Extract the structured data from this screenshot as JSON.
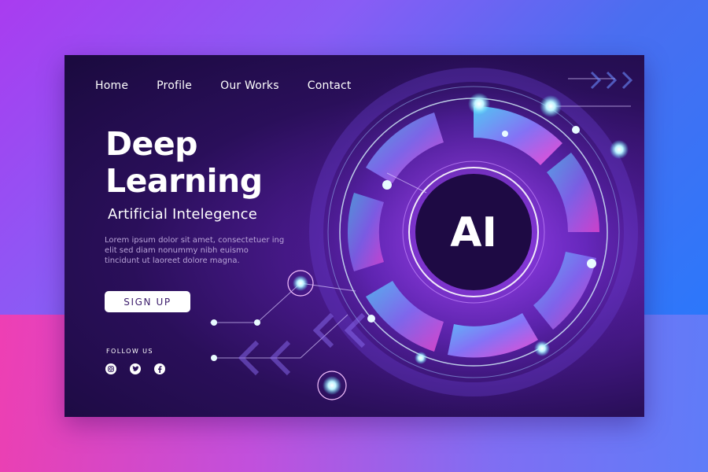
{
  "nav": {
    "items": [
      {
        "label": "Home"
      },
      {
        "label": "Profile"
      },
      {
        "label": "Our Works"
      },
      {
        "label": "Contact"
      }
    ]
  },
  "hero": {
    "title_line1": "Deep",
    "title_line2": "Learning",
    "subtitle": "Artificial Intelegence",
    "body": "Lorem ipsum dolor sit amet, consectetuer ing elit sed diam nonummy nibh euismo tincidunt ut laoreet dolore magna.",
    "cta_label": "SIGN UP"
  },
  "social": {
    "heading": "FOLLOW US",
    "icons": [
      "instagram-icon",
      "twitter-icon",
      "facebook-icon"
    ]
  },
  "art": {
    "center_label": "AI"
  },
  "colors": {
    "accent_pink": "#ff3aa8",
    "accent_cyan": "#5fe6ff",
    "card_dark": "#1a0a3e",
    "text_primary": "#ffffff",
    "text_muted": "#b9a4d8"
  }
}
